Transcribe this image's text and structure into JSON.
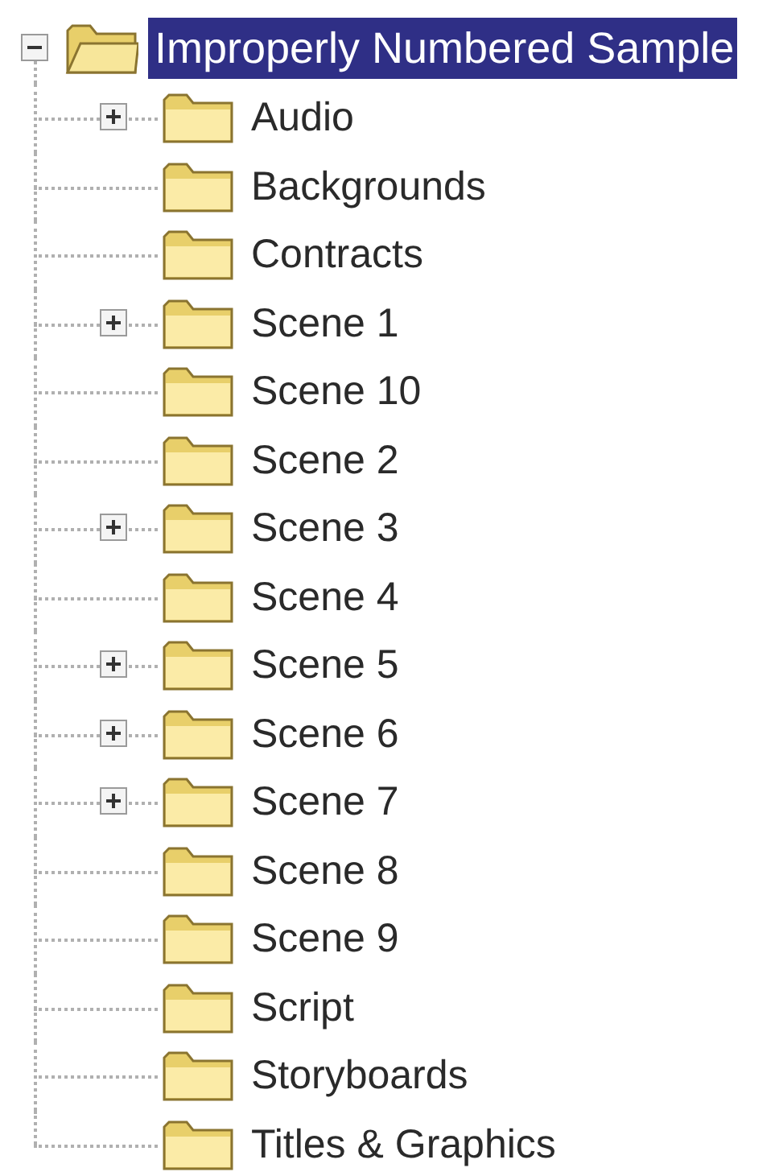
{
  "tree": {
    "root": {
      "label": "Improperly Numbered Sample",
      "expanded": true,
      "selected": true
    },
    "children": [
      {
        "label": "Audio",
        "expandable": true,
        "expanded": false,
        "selected": false
      },
      {
        "label": "Backgrounds",
        "expandable": false,
        "selected": false
      },
      {
        "label": "Contracts",
        "expandable": false,
        "selected": false
      },
      {
        "label": "Scene 1",
        "expandable": true,
        "expanded": false,
        "selected": false
      },
      {
        "label": "Scene 10",
        "expandable": false,
        "selected": false
      },
      {
        "label": "Scene 2",
        "expandable": false,
        "selected": false
      },
      {
        "label": "Scene 3",
        "expandable": true,
        "expanded": false,
        "selected": false
      },
      {
        "label": "Scene 4",
        "expandable": false,
        "selected": false
      },
      {
        "label": "Scene 5",
        "expandable": true,
        "expanded": false,
        "selected": false
      },
      {
        "label": "Scene 6",
        "expandable": true,
        "expanded": false,
        "selected": false
      },
      {
        "label": "Scene 7",
        "expandable": true,
        "expanded": false,
        "selected": false
      },
      {
        "label": "Scene 8",
        "expandable": false,
        "selected": false
      },
      {
        "label": "Scene 9",
        "expandable": false,
        "selected": false
      },
      {
        "label": "Script",
        "expandable": false,
        "selected": false
      },
      {
        "label": "Storyboards",
        "expandable": false,
        "selected": false
      },
      {
        "label": "Titles & Graphics",
        "expandable": false,
        "selected": false
      }
    ]
  }
}
